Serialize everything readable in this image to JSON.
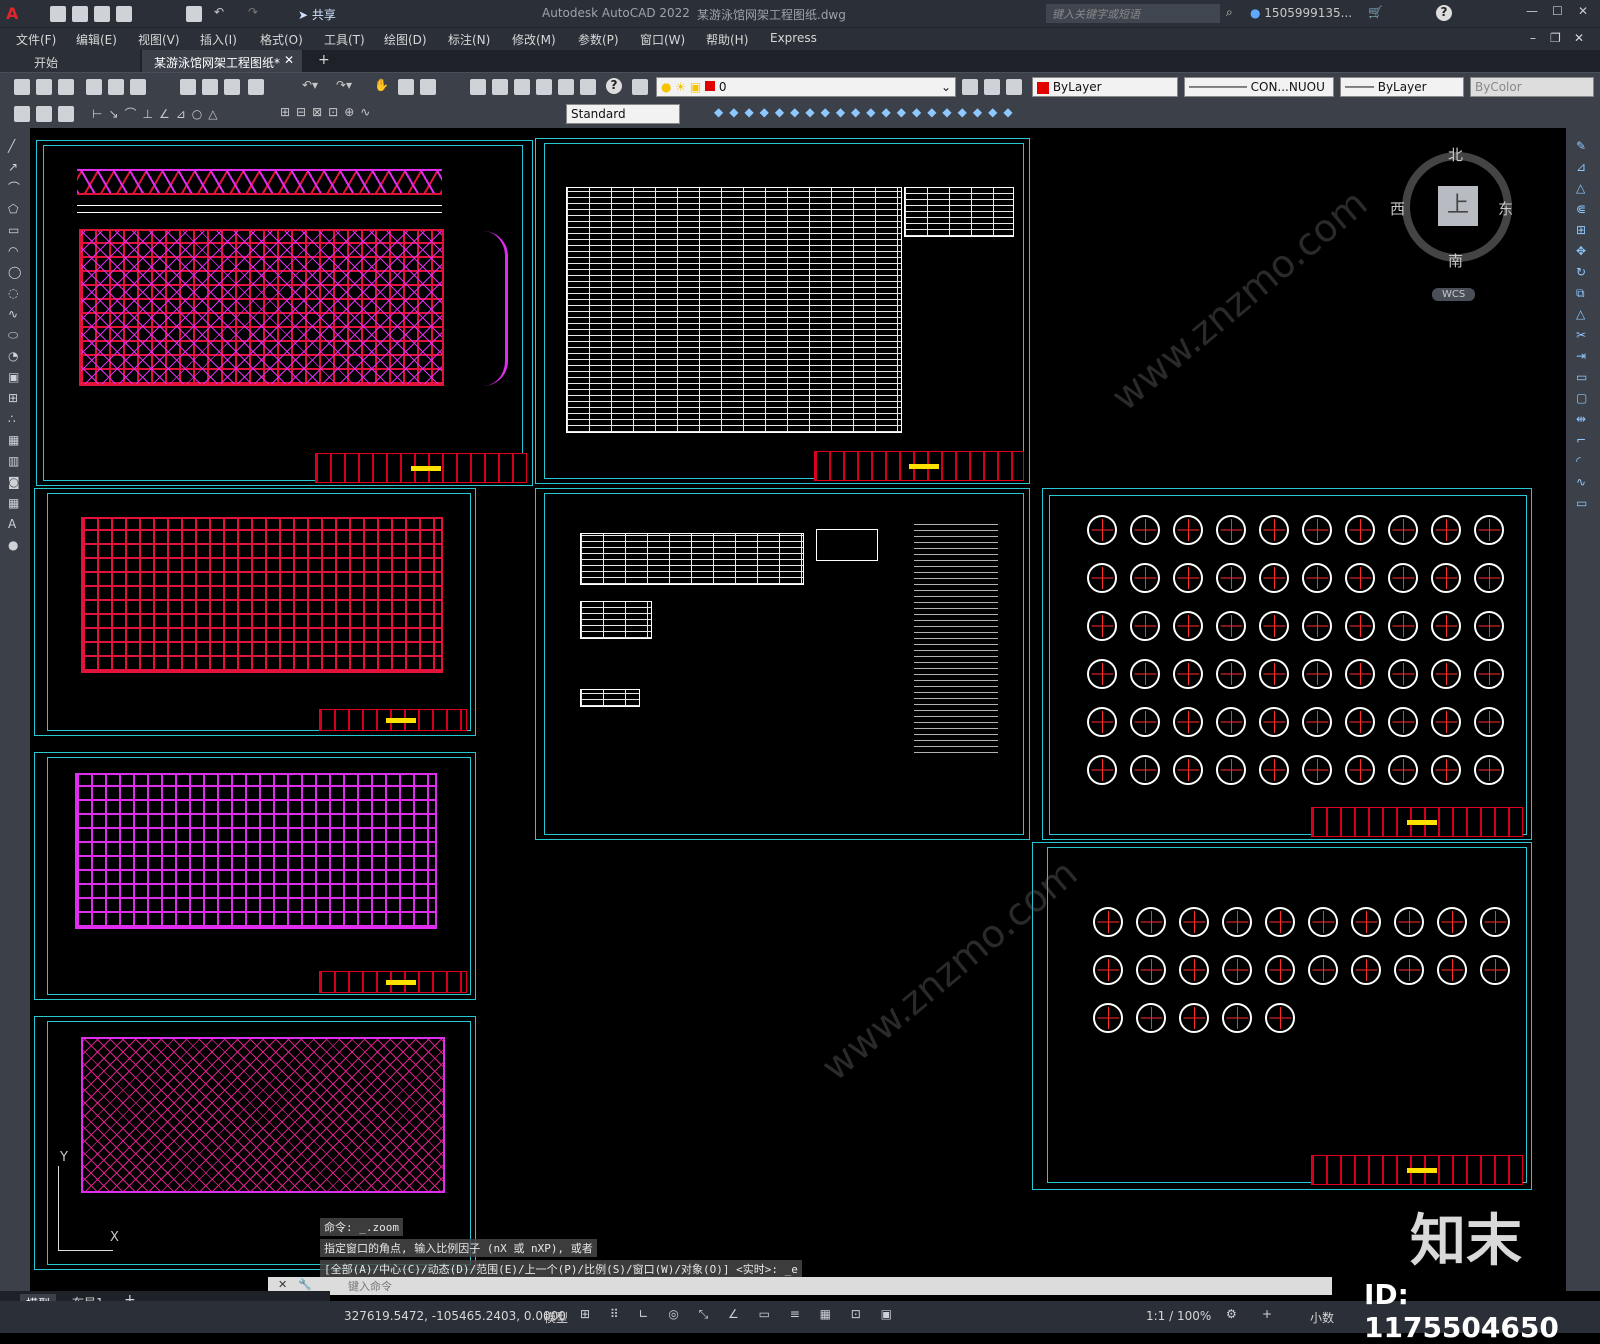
{
  "titlebar": {
    "app_title": "Autodesk AutoCAD 2022",
    "file_title": "某游泳馆网架工程图纸.dwg",
    "share_label": "共享",
    "search_placeholder": "键入关键字或短语",
    "user": "1505999135...",
    "help": "?"
  },
  "menu": [
    "文件(F)",
    "编辑(E)",
    "视图(V)",
    "插入(I)",
    "格式(O)",
    "工具(T)",
    "绘图(D)",
    "标注(N)",
    "修改(M)",
    "参数(P)",
    "窗口(W)",
    "帮助(H)",
    "Express"
  ],
  "tabs": {
    "start": "开始",
    "doc": "某游泳馆网架工程图纸*",
    "add": "+"
  },
  "toolbar": {
    "layer_value": "0",
    "color_value": "ByLayer",
    "linetype_value": "CON...NUOU",
    "lineweight_value": "ByLayer",
    "plotstyle_value": "ByColor",
    "textstyle_value": "Standard"
  },
  "viewcube": {
    "north": "北",
    "south": "南",
    "east": "东",
    "west": "西",
    "top": "上",
    "wcs": "WCS"
  },
  "ucs": {
    "x": "X",
    "y": "Y"
  },
  "command": {
    "line1": "命令:  _.zoom",
    "line2": "指定窗口的角点, 输入比例因子 (nX 或 nXP), 或者",
    "line3": "[全部(A)/中心(C)/动态(D)/范围(E)/上一个(P)/比例(S)/窗口(W)/对象(O)] <实时>: _e",
    "placeholder": "键入命令"
  },
  "layout_tabs": {
    "model": "模型",
    "layout1": "布局1",
    "add": "+"
  },
  "status": {
    "coords": "327619.5472, -105465.2403, 0.0000",
    "space": "模型",
    "scale": "1:1 / 100%",
    "units": "小数"
  },
  "watermark": {
    "brand": "知末",
    "id": "ID: 1175504650",
    "site": "www.znzmo.com"
  }
}
